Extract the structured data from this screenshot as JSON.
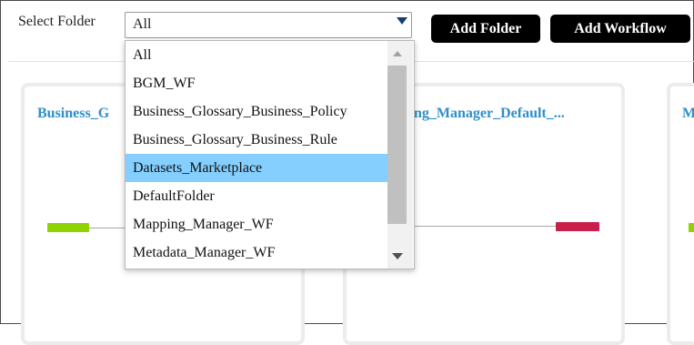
{
  "toolbar": {
    "select_label": "Select Folder",
    "selected_value": "All",
    "add_folder_label": "Add Folder",
    "add_workflow_label": "Add Workflow"
  },
  "cards": [
    {
      "title": "Business_G"
    },
    {
      "title": "ng_Manager_Default_..."
    },
    {
      "title": "M"
    }
  ],
  "dropdown": {
    "options": [
      "All",
      "BGM_WF",
      "Business_Glossary_Business_Policy",
      "Business_Glossary_Business_Rule",
      "Datasets_Marketplace",
      "DefaultFolder",
      "Mapping_Manager_WF",
      "Metadata_Manager_WF"
    ],
    "highlighted": "Datasets_Marketplace"
  },
  "colors": {
    "highlight": "#84cfff",
    "card_title": "#2f8fc8",
    "start_node": "#8fd400",
    "end_node": "#c8204b",
    "button_bg": "#000000"
  }
}
